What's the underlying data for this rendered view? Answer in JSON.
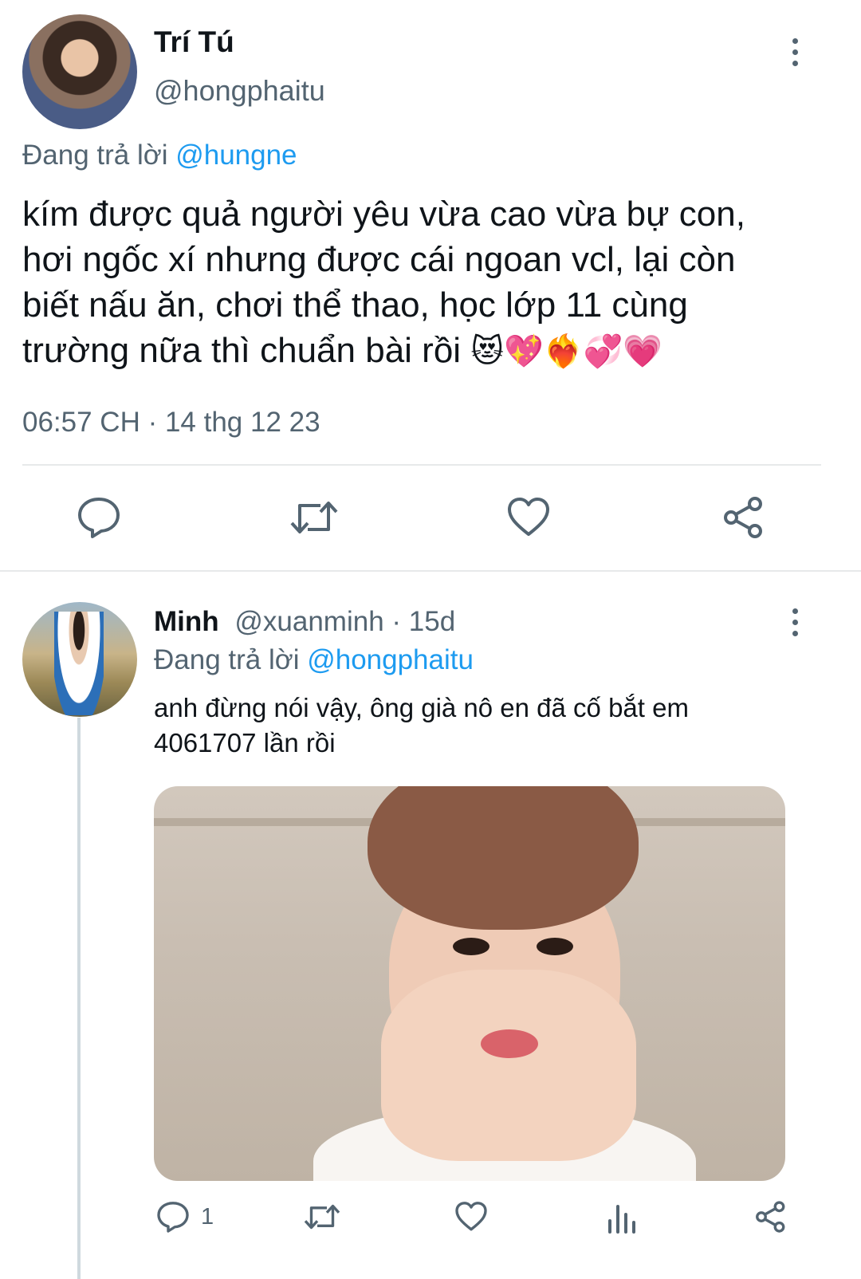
{
  "tweet": {
    "display_name": "Trí Tú",
    "handle": "@hongphaitu",
    "replying_prefix": "Đang trả lời",
    "replying_to": "@hungne",
    "text_lines": [
      "kím được quả người yêu vừa cao vừa bự con,",
      "hơi ngốc xí nhưng được cái ngoan vcl, lại còn",
      "biết nấu ăn, chơi thể thao, học lớp 11 cùng",
      "trường nữa thì chuẩn bài rồi"
    ],
    "emojis": "😻💖❤️‍🔥💞💗",
    "timestamp": "06:57 CH · 14 thg 12 23",
    "actions": [
      "reply-icon",
      "retweet-icon",
      "like-icon",
      "share-icon"
    ]
  },
  "reply": {
    "display_name": "Minh",
    "handle_time": "@xuanminh · 15d",
    "replying_prefix": "Đang trả lời",
    "replying_to": "@hongphaitu",
    "text_lines": [
      "anh đừng nói vậy, ông già nô en đã cố bắt em",
      "4061707 lần rồi"
    ],
    "reply_count": "1",
    "actions": [
      "reply-icon",
      "retweet-icon",
      "like-icon",
      "views-icon",
      "share-icon"
    ]
  },
  "colors": {
    "link": "#1d9bf0",
    "muted": "#536471",
    "divider": "#e7e9ea",
    "text": "#0f1419"
  }
}
